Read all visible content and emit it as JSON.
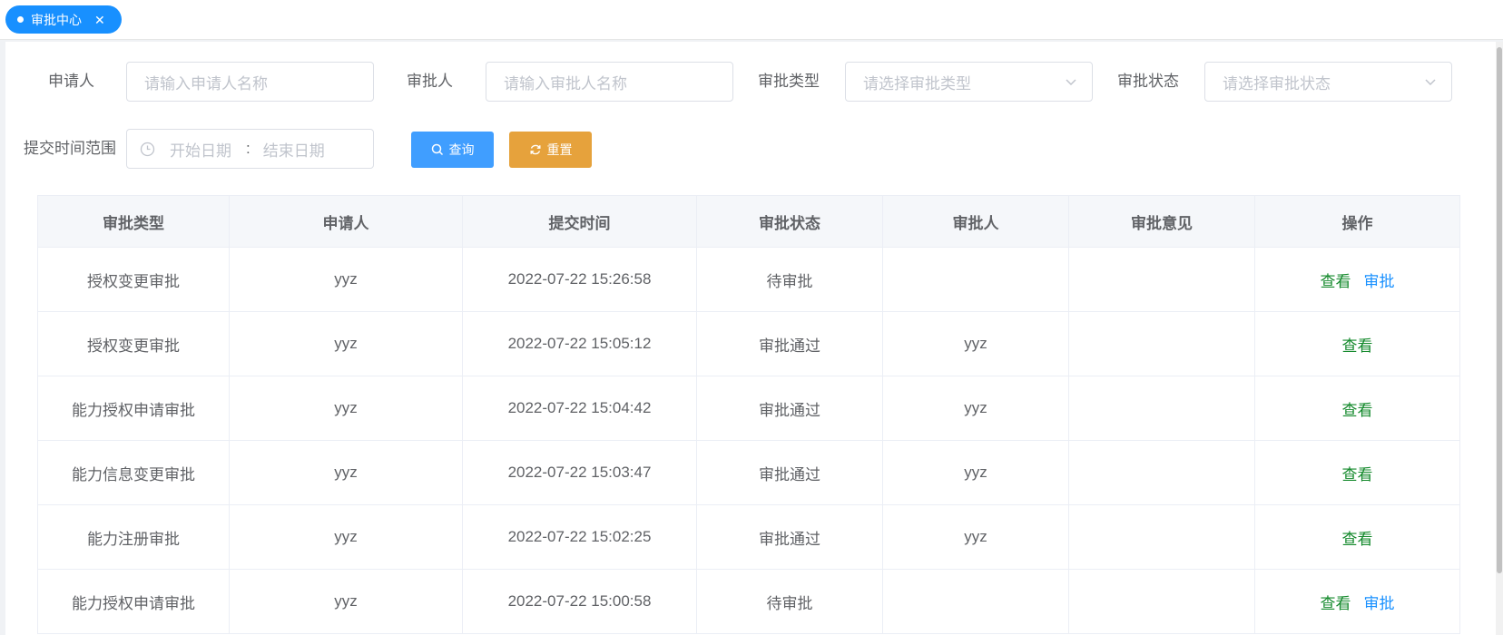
{
  "tab": {
    "label": "审批中心",
    "close": "✕"
  },
  "filters": {
    "applicant_label": "申请人",
    "applicant_placeholder": "请输入申请人名称",
    "approver_label": "审批人",
    "approver_placeholder": "请输入审批人名称",
    "type_label": "审批类型",
    "type_placeholder": "请选择审批类型",
    "status_label": "审批状态",
    "status_placeholder": "请选择审批状态",
    "time_label": "提交时间范围",
    "start_placeholder": "开始日期",
    "separator": ":",
    "end_placeholder": "结束日期",
    "query_button": "查询",
    "reset_button": "重置"
  },
  "table": {
    "columns": [
      "审批类型",
      "申请人",
      "提交时间",
      "审批状态",
      "审批人",
      "审批意见",
      "操作"
    ],
    "view_label": "查看",
    "approve_label": "审批",
    "rows": [
      {
        "type": "授权变更审批",
        "applicant": "yyz",
        "time": "2022-07-22 15:26:58",
        "status": "待审批",
        "approver": "",
        "opinion": "",
        "can_approve": true
      },
      {
        "type": "授权变更审批",
        "applicant": "yyz",
        "time": "2022-07-22 15:05:12",
        "status": "审批通过",
        "approver": "yyz",
        "opinion": "",
        "can_approve": false
      },
      {
        "type": "能力授权申请审批",
        "applicant": "yyz",
        "time": "2022-07-22 15:04:42",
        "status": "审批通过",
        "approver": "yyz",
        "opinion": "",
        "can_approve": false
      },
      {
        "type": "能力信息变更审批",
        "applicant": "yyz",
        "time": "2022-07-22 15:03:47",
        "status": "审批通过",
        "approver": "yyz",
        "opinion": "",
        "can_approve": false
      },
      {
        "type": "能力注册审批",
        "applicant": "yyz",
        "time": "2022-07-22 15:02:25",
        "status": "审批通过",
        "approver": "yyz",
        "opinion": "",
        "can_approve": false
      },
      {
        "type": "能力授权申请审批",
        "applicant": "yyz",
        "time": "2022-07-22 15:00:58",
        "status": "待审批",
        "approver": "",
        "opinion": "",
        "can_approve": true
      }
    ]
  }
}
